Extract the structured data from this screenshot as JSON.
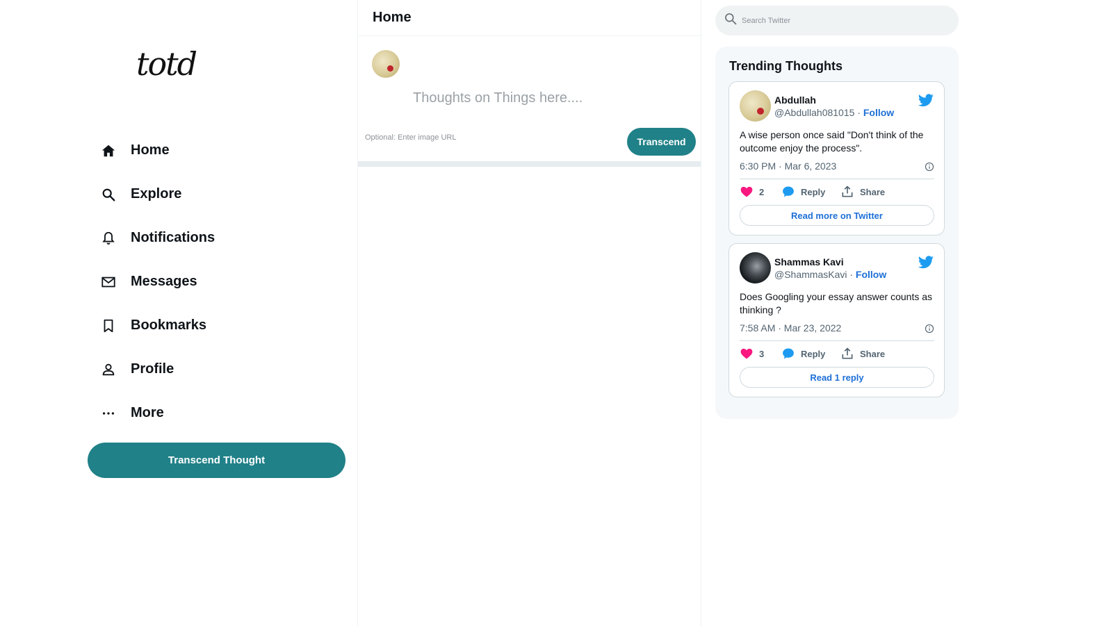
{
  "app": {
    "logo_text": "totd"
  },
  "sidebar": {
    "items": [
      {
        "label": "Home",
        "icon": "home-icon"
      },
      {
        "label": "Explore",
        "icon": "search-icon"
      },
      {
        "label": "Notifications",
        "icon": "bell-icon"
      },
      {
        "label": "Messages",
        "icon": "mail-icon"
      },
      {
        "label": "Bookmarks",
        "icon": "bookmark-icon"
      },
      {
        "label": "Profile",
        "icon": "person-icon"
      },
      {
        "label": "More",
        "icon": "more-dots-icon"
      }
    ],
    "cta_label": "Transcend Thought"
  },
  "feed": {
    "title": "Home",
    "composer": {
      "placeholder": "Thoughts on Things here....",
      "image_placeholder": "Optional: Enter image URL",
      "submit_label": "Transcend"
    }
  },
  "search": {
    "placeholder": "Search Twitter"
  },
  "trending": {
    "title": "Trending Thoughts",
    "tweets": [
      {
        "name": "Abdullah",
        "handle": "@Abdullah081015",
        "dot": "·",
        "follow": "Follow",
        "text": "A wise person once said \"Don't think of the outcome enjoy the process\".",
        "time": "6:30 PM · Mar 6, 2023",
        "likes": "2",
        "reply": "Reply",
        "share": "Share",
        "read": "Read more on Twitter"
      },
      {
        "name": "Shammas Kavi",
        "handle": "@ShammasKavi",
        "dot": "·",
        "follow": "Follow",
        "text": "Does Googling your essay answer counts as thinking ?",
        "time": "7:58 AM · Mar 23, 2022",
        "likes": "3",
        "reply": "Reply",
        "share": "Share",
        "read": "Read 1 reply"
      }
    ]
  },
  "colors": {
    "accent": "#208188",
    "link": "#1d6fd6",
    "like": "#f91880",
    "reply": "#1d9bf0",
    "twitter_blue": "#1d9bf0"
  }
}
